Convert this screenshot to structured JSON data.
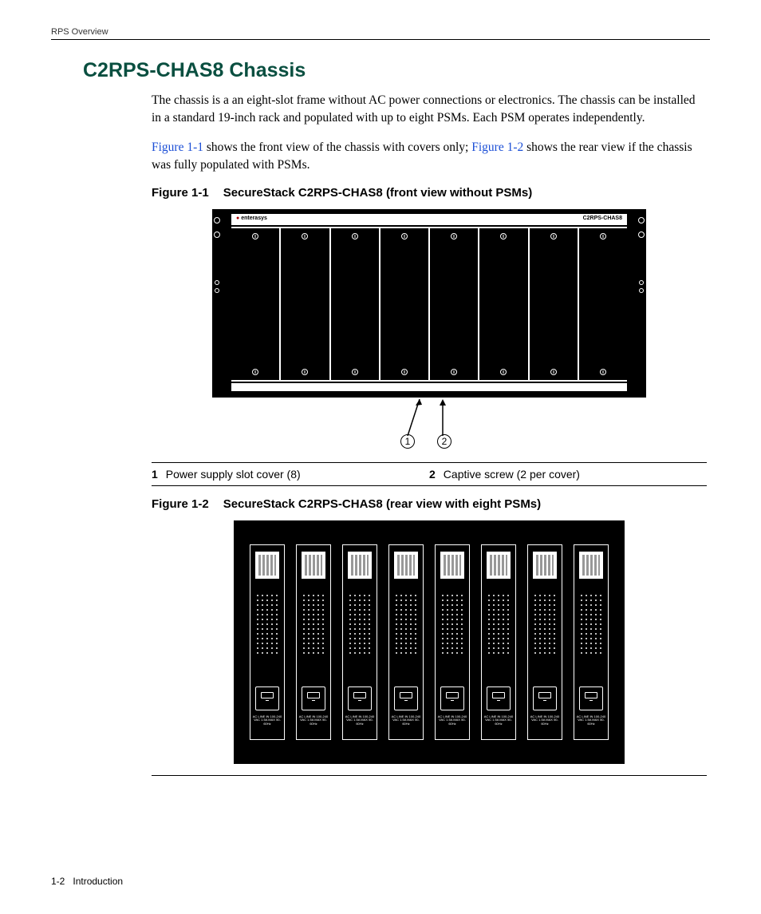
{
  "running_head": "RPS Overview",
  "section_title": "C2RPS-CHAS8 Chassis",
  "para1": "The chassis is a an eight-slot frame without AC power connections or electronics. The chassis can be installed in a standard 19-inch rack and populated with up to eight PSMs. Each PSM operates independently.",
  "para2_a": " shows the front view of the chassis with covers only; ",
  "para2_b": " shows the rear view if the chassis was fully populated with PSMs.",
  "xref1": "Figure 1-1",
  "xref2": "Figure 1-2",
  "fig1": {
    "num": "Figure 1-1",
    "title": "SecureStack C2RPS-CHAS8 (front view without PSMs)"
  },
  "fig2": {
    "num": "Figure 1-2",
    "title": "SecureStack C2RPS-CHAS8 (rear view with eight PSMs)"
  },
  "brand": "enterasys",
  "model": "C2RPS-CHAS8",
  "callout1": "1",
  "callout2": "2",
  "legend": {
    "n1": "1",
    "t1": "Power supply slot cover (8)",
    "n2": "2",
    "t2": "Captive screw (2 per cover)"
  },
  "psm_spec": "AC LINE IN\n100-240 VAC\n1.5A MAX\n50-60Hz",
  "footer": {
    "page": "1-2",
    "chapter": "Introduction"
  }
}
